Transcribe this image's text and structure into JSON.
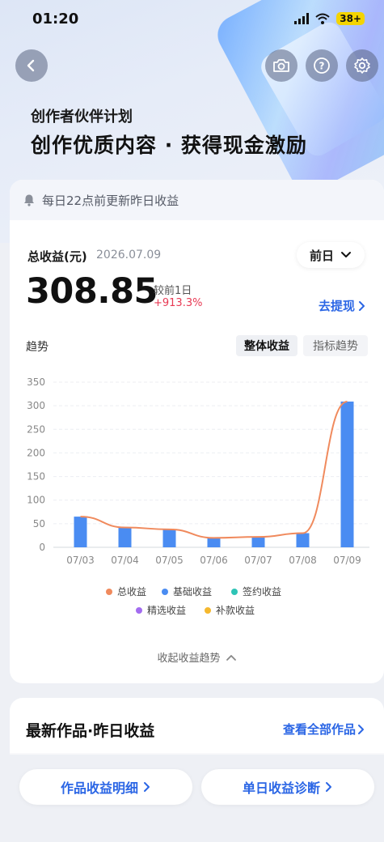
{
  "status_bar": {
    "time": "01:20",
    "battery": "38+"
  },
  "hero": {
    "subtitle": "创作者伙伴计划",
    "title": "创作优质内容 · 获得现金激励"
  },
  "notice": {
    "text": "每日22点前更新昨日收益"
  },
  "earnings": {
    "label": "总收益(元)",
    "date": "2026.07.09",
    "period": "前日",
    "amount": "308.85",
    "compare_label": "较前1日",
    "compare_value": "+913.3%",
    "withdraw": "去提现"
  },
  "trend": {
    "label": "趋势",
    "tabs": [
      "整体收益",
      "指标趋势"
    ],
    "collapse": "收起收益趋势"
  },
  "chart_data": {
    "type": "bar",
    "categories": [
      "07/03",
      "07/04",
      "07/05",
      "07/06",
      "07/07",
      "07/08",
      "07/09"
    ],
    "series": [
      {
        "name": "总收益",
        "type": "line",
        "color": "#f08a5d",
        "values": [
          65,
          42,
          38,
          20,
          22,
          30,
          308.85
        ]
      },
      {
        "name": "基础收益",
        "type": "bar",
        "color": "#4a8cf2",
        "values": [
          65,
          42,
          38,
          20,
          22,
          30,
          308.85
        ]
      },
      {
        "name": "签约收益",
        "type": "bar",
        "color": "#2ec4b6",
        "values": [
          0,
          0,
          0,
          0,
          0,
          0,
          0
        ]
      },
      {
        "name": "精选收益",
        "type": "bar",
        "color": "#a36cf0",
        "values": [
          0,
          0,
          0,
          0,
          0,
          0,
          0
        ]
      },
      {
        "name": "补款收益",
        "type": "bar",
        "color": "#f5b82e",
        "values": [
          0,
          0,
          0,
          0,
          0,
          0,
          0
        ]
      }
    ],
    "yticks": [
      0,
      50,
      100,
      150,
      200,
      250,
      300,
      350
    ],
    "ylim": [
      0,
      350
    ],
    "grid": true,
    "legend_position": "bottom"
  },
  "latest": {
    "title": "最新作品·昨日收益",
    "view_all": "查看全部作品"
  },
  "bottom": {
    "left": "作品收益明细",
    "right": "单日收益诊断"
  }
}
